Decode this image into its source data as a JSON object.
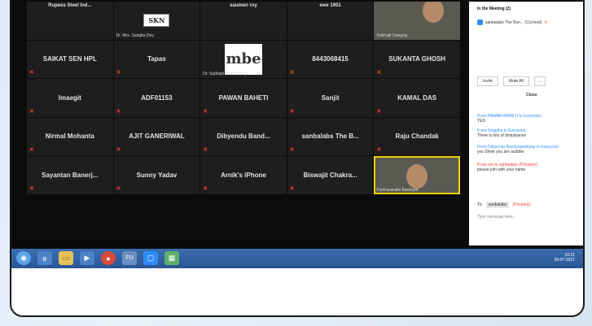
{
  "tiles": [
    {
      "label": "Rupees Steel Ind...",
      "kind": "text"
    },
    {
      "label": "SKN",
      "kind": "logo",
      "caption": "Dr. Mrs. Sangita Dey"
    },
    {
      "label": "saumen roy",
      "kind": "text"
    },
    {
      "label": "ewe 1951",
      "kind": "text"
    },
    {
      "label": "",
      "kind": "video",
      "caption": "Subhajit Ganguly"
    },
    {
      "label": "SAIKAT SEN HPL",
      "kind": "text"
    },
    {
      "label": "Tapas",
      "kind": "text"
    },
    {
      "label": "mbe",
      "kind": "logo2",
      "caption": "Dr. Subhajit Bhattacharya"
    },
    {
      "label": "8443068415",
      "kind": "text"
    },
    {
      "label": "SUKANTA GHOSH",
      "kind": "text"
    },
    {
      "label": "Imaegit",
      "kind": "text"
    },
    {
      "label": "ADF01153",
      "kind": "text"
    },
    {
      "label": "PAWAN BAHETI",
      "kind": "text"
    },
    {
      "label": "Sanjit",
      "kind": "text"
    },
    {
      "label": "KAMAL DAS",
      "kind": "text"
    },
    {
      "label": "Nirmal Mohanta",
      "kind": "text"
    },
    {
      "label": "AJIT GANERIWAL",
      "kind": "text"
    },
    {
      "label": "Dibyendu Band...",
      "kind": "text"
    },
    {
      "label": "sanbalabs The B...",
      "kind": "text"
    },
    {
      "label": "Raju Chandak",
      "kind": "text"
    },
    {
      "label": "Sayantan Banerj...",
      "kind": "text"
    },
    {
      "label": "Sunny Yadav",
      "kind": "text"
    },
    {
      "label": "Arnik's iPhone",
      "kind": "text"
    },
    {
      "label": "Biswajit Chakra...",
      "kind": "text"
    },
    {
      "label": "",
      "kind": "video-active",
      "caption": "Parthasarathi Banerjee"
    }
  ],
  "chat": {
    "header": "In the Meeting (2)",
    "participant": "sanbalabs The Bon... (Co-host)",
    "btn_invite": "Invite",
    "btn_mute": "Mute All",
    "btn_more": "...",
    "btn_close": "Close",
    "messages": [
      {
        "from": "From PAWAN BAHETI to Everyone:",
        "text": "YES"
      },
      {
        "from": "From Snigdha to Everyone:",
        "text": "There is lots of disturbance"
      },
      {
        "from": "From Dibyendu Bandyopadhyay to Everyone:",
        "text": "yes Sheik you are audible"
      },
      {
        "from": "From me to sanbalabs (Privately):",
        "text": "please join with your name"
      }
    ],
    "to_label": "To:",
    "to_value": "sanbalabs",
    "privately": "(Privately)",
    "input_placeholder": "Type message here..."
  },
  "taskbar": {
    "time": "10:21",
    "date": "28-07-2021",
    "app_label": "FU"
  }
}
